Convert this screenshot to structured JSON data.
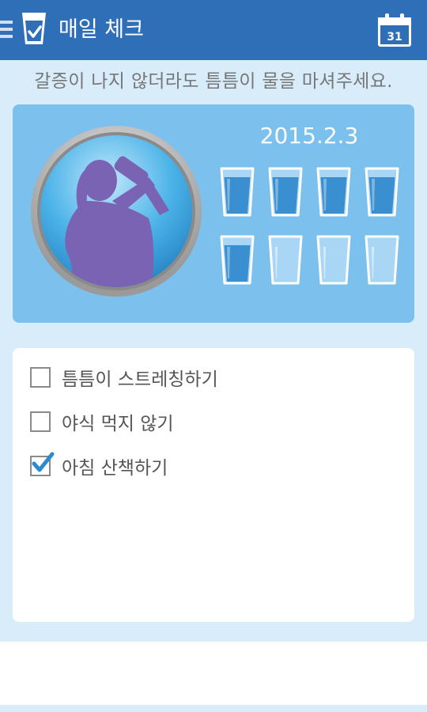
{
  "app_bar": {
    "title": "매일 체크",
    "menu_icon": "menu-icon",
    "app_icon": "water-glass-check-icon",
    "calendar_icon": "calendar-icon",
    "calendar_day": "31"
  },
  "hint": "갈증이 나지 않더라도 틈틈이 물을 마셔주세요.",
  "water": {
    "date": "2015.2.3",
    "glasses": [
      {
        "filled": true
      },
      {
        "filled": true
      },
      {
        "filled": true
      },
      {
        "filled": true
      },
      {
        "filled": true
      },
      {
        "filled": false
      },
      {
        "filled": false
      },
      {
        "filled": false
      }
    ],
    "colors": {
      "card": "#7cc0ee",
      "water": "#3a8fd0",
      "avatar_figure": "#7b63b3"
    }
  },
  "checklist": {
    "items": [
      {
        "label": "틈틈이 스트레칭하기",
        "checked": false
      },
      {
        "label": "야식 먹지 않기",
        "checked": false
      },
      {
        "label": "아침 산책하기",
        "checked": true
      }
    ]
  },
  "colors": {
    "app_bar": "#2f6fb7",
    "background": "#d9ecf9",
    "check_accent": "#2a8ad0"
  }
}
